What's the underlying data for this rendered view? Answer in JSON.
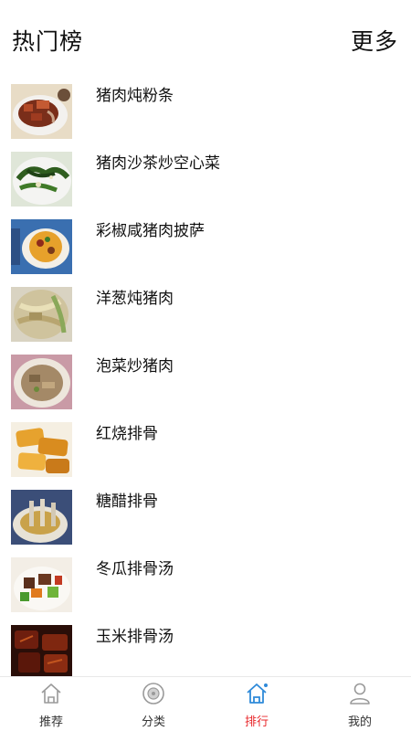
{
  "header": {
    "title": "热门榜",
    "more_label": "更多"
  },
  "recipes": [
    {
      "name": "猪肉炖粉条"
    },
    {
      "name": "猪肉沙茶炒空心菜"
    },
    {
      "name": "彩椒咸猪肉披萨"
    },
    {
      "name": "洋葱炖猪肉"
    },
    {
      "name": "泡菜炒猪肉"
    },
    {
      "name": "红烧排骨"
    },
    {
      "name": "糖醋排骨"
    },
    {
      "name": "冬瓜排骨汤"
    },
    {
      "name": "玉米排骨汤"
    }
  ],
  "tabbar": {
    "items": [
      {
        "label": "推荐",
        "icon": "home-icon"
      },
      {
        "label": "分类",
        "icon": "disc-icon"
      },
      {
        "label": "排行",
        "icon": "home-icon"
      },
      {
        "label": "我的",
        "icon": "user-icon"
      }
    ],
    "active_index": 2,
    "active_color": "#e8262a",
    "inactive_color": "#9a9a9a",
    "active_icon_color": "#2f8ad9"
  }
}
